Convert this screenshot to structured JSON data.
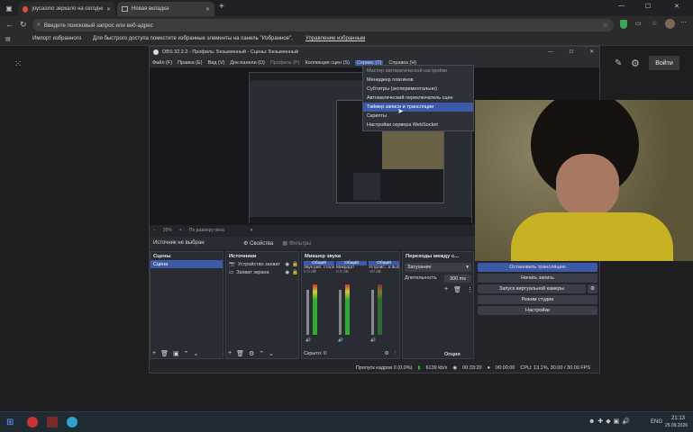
{
  "browser": {
    "tabs": [
      {
        "title": "joycasino зеркало на сегодня —",
        "active": false
      },
      {
        "title": "Новая вкладка",
        "active": true
      }
    ],
    "address_placeholder": "Введите поисковый запрос или веб-адрес",
    "bookmarks_import": "Импорт избранного",
    "bookmarks_hint": "Для быстрого доступа поместите избранные элементы на панель \"Избранное\".",
    "bookmarks_manage": "Управление избранным",
    "signin_label": "Войти"
  },
  "obs": {
    "title": "OBS 32.2.2 - Профиль: Безымянный - Сцены: Безымянный",
    "menu": [
      "Файл (F)",
      "Правка (E)",
      "Вид (V)",
      "Док-панели (D)",
      "Профиль (P)",
      "Коллекция сцен (S)",
      "Сервис (T)",
      "Справка (H)"
    ],
    "service_menu": [
      "Мастер автоматической настройки",
      "Менеджер плагинов",
      "Субтитры (экспериментально)",
      "Автоматический переключатель сцен",
      "Таймер записи и трансляции",
      "Скрипты",
      "Настройки сервера WebSocket"
    ],
    "zoom": "35%",
    "zoom_mode": "По размеру окна",
    "no_source": "Источник не выбран",
    "properties_label": "Свойства",
    "filters_label": "Фильтры",
    "scenes": {
      "header": "Сцены",
      "items": [
        "Сцена"
      ]
    },
    "sources": {
      "header": "Источники",
      "items": [
        "Устройство захват",
        "Захват экрана"
      ]
    },
    "mixer": {
      "header": "Микшер звука",
      "channels": [
        {
          "tag": "Общий",
          "name": "Звук раб. стола",
          "db": "0.0 dB"
        },
        {
          "tag": "Общий",
          "name": "Микр/дот",
          "db": "0.0 dB"
        },
        {
          "tag": "Общий",
          "name": "Устройс...а выб",
          "db": "-inf dB"
        }
      ]
    },
    "transitions": {
      "header": "Переходы между с...",
      "type": "Затухание",
      "duration_label": "Длительность",
      "duration_value": "300 ms"
    },
    "controls": {
      "stream": "Остановить трансляцию",
      "record": "Начать запись",
      "virtualcam": "Запуск виртуальной камеры",
      "studio": "Режим студии",
      "settings": "Настройки"
    },
    "status": {
      "fade": "Скрыто: 0",
      "options": "Опции",
      "dropped": "Пропуск кадров 0 (0.0%)",
      "bitrate": "6139 kb/s",
      "time": "00:33:20",
      "time2": "00:00:00",
      "cpu": "CPU: 13.1%, 30.00 / 30.00 FPS"
    }
  },
  "taskbar": {
    "lang": "ENG",
    "time": "21:13",
    "date": "25.09.2026"
  }
}
